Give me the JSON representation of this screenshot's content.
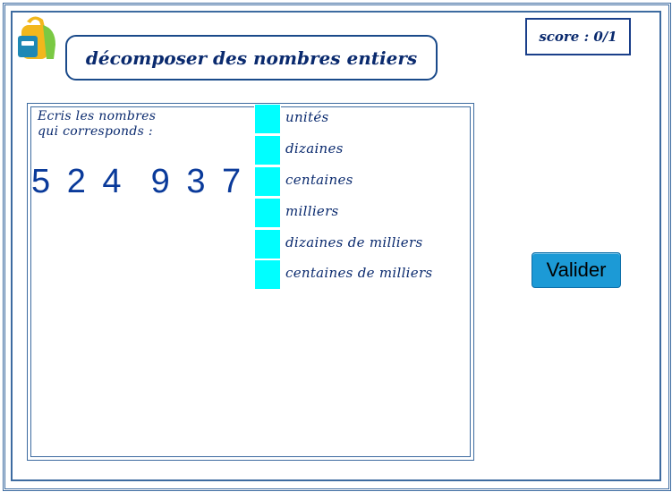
{
  "header": {
    "title": "décomposer des nombres entiers",
    "score": "score : 0/1"
  },
  "exercise": {
    "instruction_line1": "Ecris les nombres",
    "instruction_line2": "qui corresponds :",
    "number": "5 2 4  9 3 7",
    "rows": [
      {
        "label": "unités",
        "value": ""
      },
      {
        "label": "dizaines",
        "value": ""
      },
      {
        "label": "centaines",
        "value": ""
      },
      {
        "label": "milliers",
        "value": ""
      },
      {
        "label": "dizaines de milliers",
        "value": ""
      },
      {
        "label": "centaines de milliers",
        "value": ""
      }
    ]
  },
  "actions": {
    "validate_label": "Valider"
  },
  "colors": {
    "input_cell": "#00ffff",
    "button": "#1c9ad6",
    "text": "#0a2a6e"
  },
  "icons": {
    "logo": "backpack-icon"
  }
}
